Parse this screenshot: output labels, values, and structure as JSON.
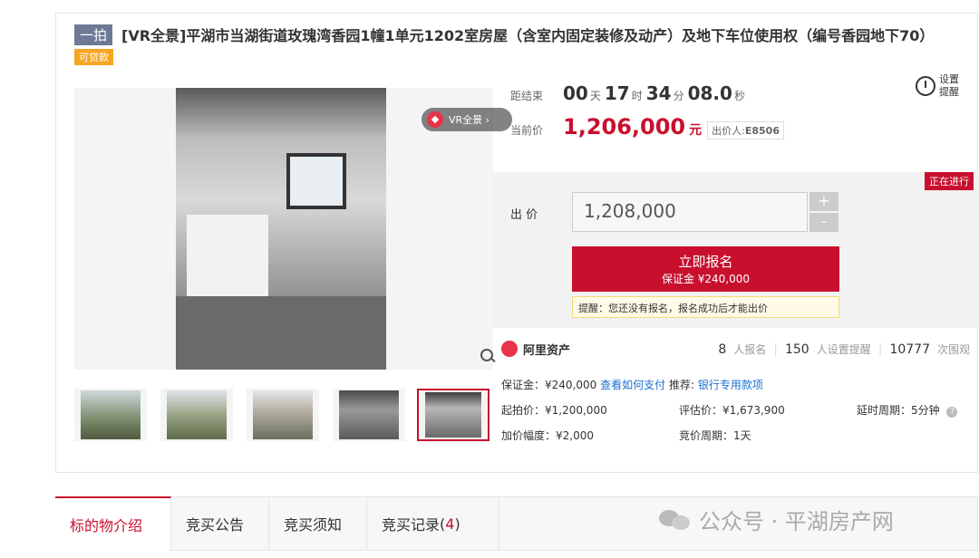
{
  "header": {
    "tag": "一拍",
    "title": "[VR全景]平湖市当湖街道玫瑰湾香园1幢1单元1202室房屋（含室内固定装修及动产）及地下车位使用权（编号香园地下70）",
    "loan_tag": "可贷款"
  },
  "gallery": {
    "vr_label": "VR全景 ›",
    "thumbnails": [
      "thumb-1",
      "thumb-2",
      "thumb-3",
      "thumb-4",
      "thumb-5"
    ],
    "active_thumbnail_index": 4
  },
  "countdown": {
    "label": "距结束",
    "days": "00",
    "days_unit": "天",
    "hours": "17",
    "hours_unit": "时",
    "minutes": "34",
    "minutes_unit": "分",
    "seconds": "08.0",
    "seconds_unit": "秒"
  },
  "price": {
    "label": "当前价",
    "value": "1,206,000",
    "unit": "元",
    "bidder_label": "出价人:",
    "bidder": "E8506"
  },
  "reminder": {
    "label": "设置提醒"
  },
  "bid": {
    "status": "正在进行",
    "label": "出 价",
    "value": "1,208,000",
    "plus": "+",
    "minus": "-",
    "signup_label": "立即报名",
    "deposit_label": "保证金 ¥240,000",
    "hint": "提醒：您还没有报名，报名成功后才能出价"
  },
  "stats": {
    "brand": "阿里资产",
    "signups": "8",
    "signups_unit": "人报名",
    "reminders": "150",
    "reminders_unit": "人设置提醒",
    "views": "10777",
    "views_unit": "次围观"
  },
  "info": {
    "deposit": "保证金：¥240,000",
    "how_to_pay": "查看如何支付",
    "recommend_label": "推荐:",
    "recommend_link": "银行专用款项",
    "start_price": "起拍价：¥1,200,000",
    "estimate": "评估价：¥1,673,900",
    "delay": "延时周期：5分钟",
    "increment": "加价幅度：¥2,000",
    "period": "竞价周期：1天"
  },
  "tabs": {
    "items": [
      {
        "label": "标的物介绍"
      },
      {
        "label": "竞买公告"
      },
      {
        "label": "竞买须知"
      },
      {
        "label": "竞买记录"
      }
    ],
    "record_count": "4",
    "watermark": "公众号 · 平湖房产网"
  },
  "colors": {
    "accent": "#c8102e",
    "link": "#1a6fd1",
    "loan": "#f5a623"
  }
}
